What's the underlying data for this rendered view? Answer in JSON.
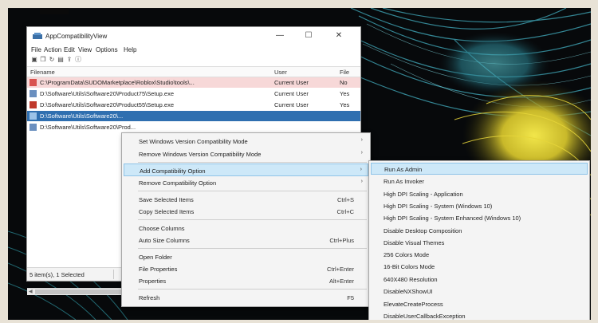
{
  "colors": {
    "selection_blue": "#2f6fb0",
    "highlight_bg": "#cde8f8",
    "row_error_bg": "#f7d8d8",
    "menu_bg": "#f4f4f4"
  },
  "window": {
    "title": "AppCompatibilityView",
    "icon": "app-icon",
    "controls": {
      "minimize": "—",
      "maximize": "☐",
      "close": "✕"
    }
  },
  "menubar": [
    "File",
    "Action",
    "Edit",
    "View",
    "Options",
    "Help"
  ],
  "toolbar": {
    "icons": [
      "save-icon",
      "copy-icon",
      "refresh-icon",
      "properties-icon",
      "export-icon",
      "info-icon"
    ]
  },
  "grid": {
    "columns": [
      "Filename",
      "User",
      "File"
    ],
    "rows": [
      {
        "filename": "C:\\ProgramData\\SUDOMarketplace\\Roblox\\Studio\\tools\\...",
        "user": "Current User",
        "file": "No",
        "icon": "file-warning-icon"
      },
      {
        "filename": "D:\\Software\\Utils\\Software20\\Product75\\Setup.exe",
        "user": "Current User",
        "file": "Yes",
        "icon": "exe-icon"
      },
      {
        "filename": "D:\\Software\\Utils\\Software20\\Product55\\Setup.exe",
        "user": "Current User",
        "file": "Yes",
        "icon": "exe-icon"
      },
      {
        "filename": "D:\\Software\\Utils\\Software20\\...",
        "user": "",
        "file": "",
        "icon": "exe-icon"
      },
      {
        "filename": "D:\\Software\\Utils\\Software20\\Prod...",
        "user": "",
        "file": "",
        "icon": "exe-icon"
      }
    ]
  },
  "statusbar": {
    "text": "5 item(s), 1 Selected"
  },
  "context_menu": {
    "items": [
      {
        "label": "Set Windows Version Compatibility Mode",
        "shortcut": "",
        "submenu": true
      },
      {
        "label": "Remove Windows Version Compatibility Mode",
        "shortcut": "",
        "submenu": true
      },
      {
        "label": "Add Compatibility Option",
        "shortcut": "",
        "submenu": true
      },
      {
        "label": "Remove Compatibility Option",
        "shortcut": "",
        "submenu": true
      },
      {
        "label": "Save Selected Items",
        "shortcut": "Ctrl+S",
        "submenu": false
      },
      {
        "label": "Copy Selected Items",
        "shortcut": "Ctrl+C",
        "submenu": false
      },
      {
        "label": "Choose Columns",
        "shortcut": "",
        "submenu": false
      },
      {
        "label": "Auto Size Columns",
        "shortcut": "Ctrl+Plus",
        "submenu": false
      },
      {
        "label": "Open Folder",
        "shortcut": "",
        "submenu": false
      },
      {
        "label": "File Properties",
        "shortcut": "Ctrl+Enter",
        "submenu": false
      },
      {
        "label": "Properties",
        "shortcut": "Alt+Enter",
        "submenu": false
      },
      {
        "label": "Refresh",
        "shortcut": "F5",
        "submenu": false
      }
    ]
  },
  "submenu": {
    "items": [
      "Run As Admin",
      "Run As Invoker",
      "High DPI Scaling - Application",
      "High DPI Scaling - System (Windows 10)",
      "High DPI Scaling - System Enhanced (Windows 10)",
      "Disable Desktop Composition",
      "Disable Visual Themes",
      "256 Colors Mode",
      "16-Bit Colors Mode",
      "640X480 Resolution",
      "DisableNXShowUI",
      "ElevateCreateProcess",
      "DisableUserCallbackException"
    ]
  }
}
